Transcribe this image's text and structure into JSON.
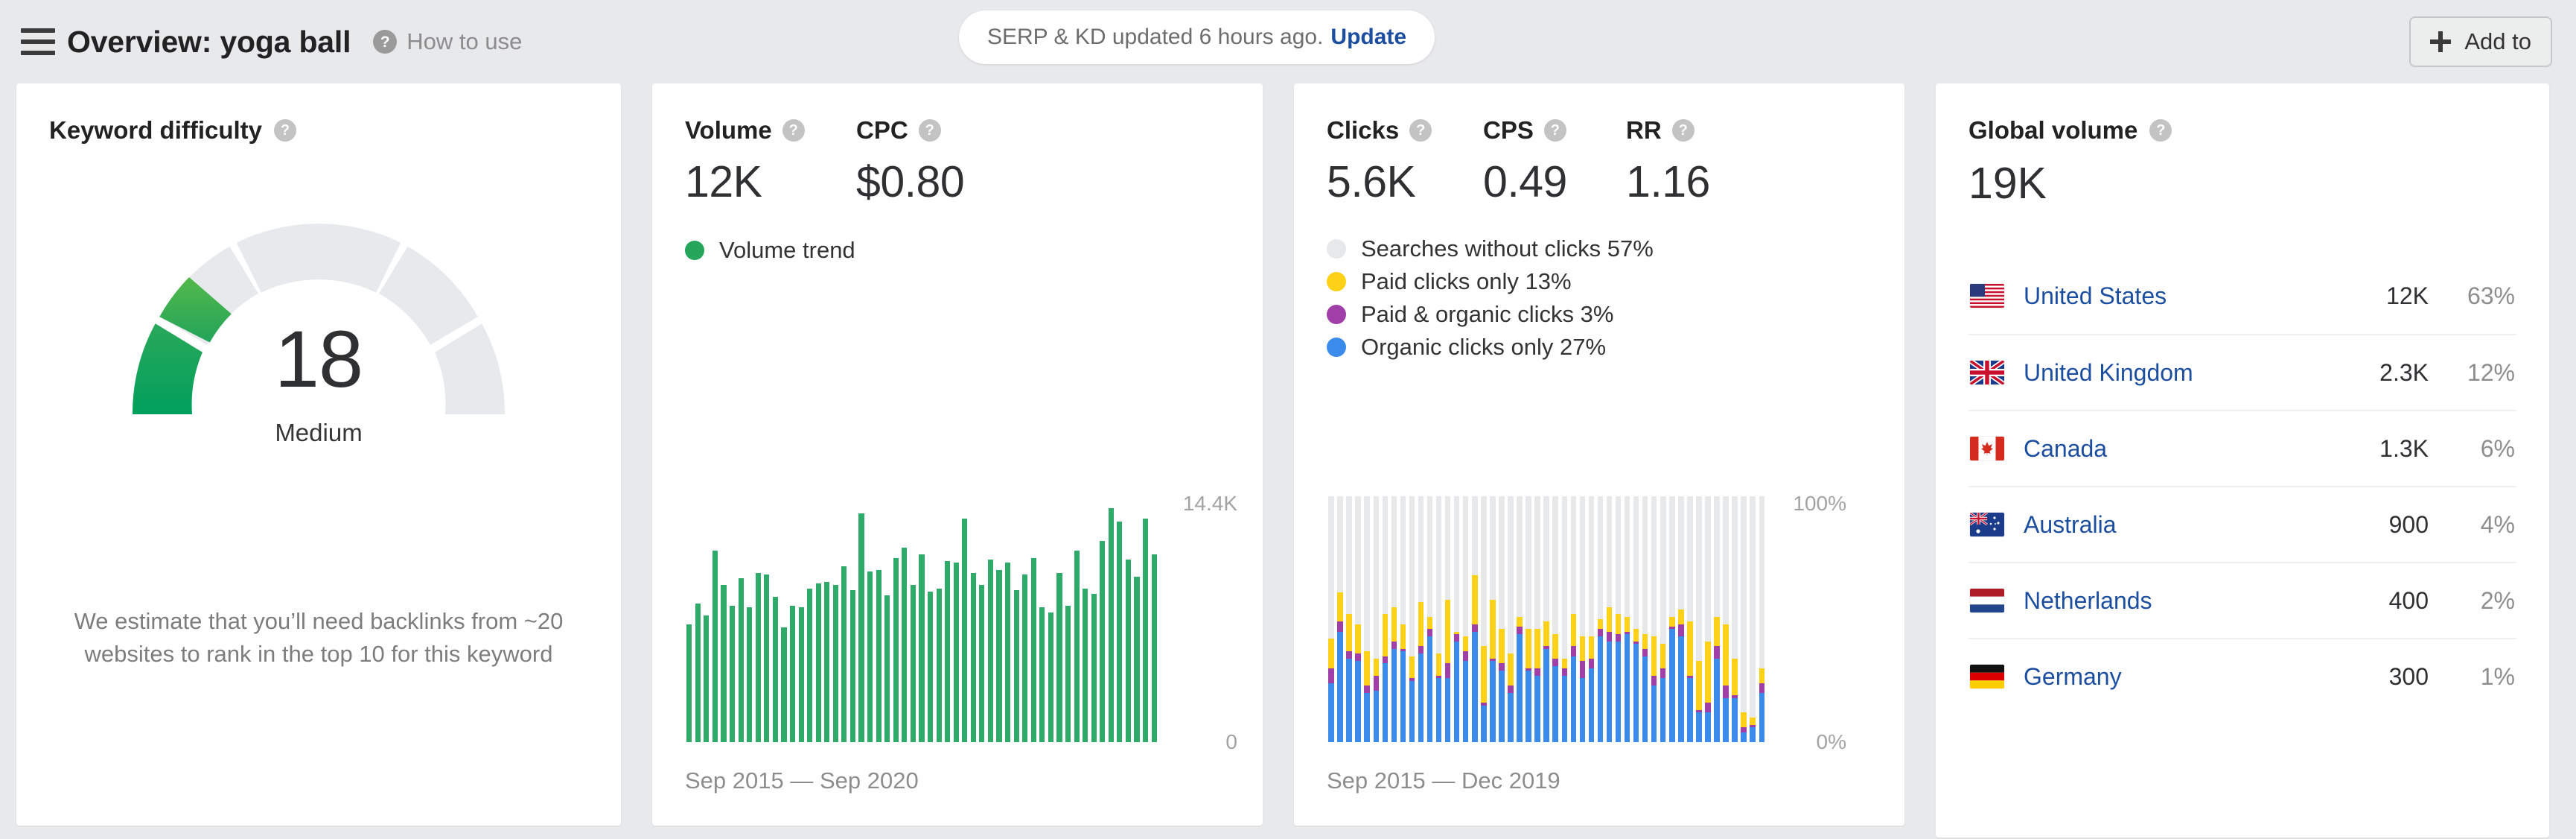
{
  "topbar": {
    "menu_icon": "hamburger-icon",
    "title": "Overview: yoga ball",
    "help_glyph": "?",
    "how_to_use": "How to use",
    "update_notice": "SERP & KD updated 6 hours ago.",
    "update_link": "Update",
    "add_to": "Add to"
  },
  "keyword_difficulty": {
    "title": "Keyword difficulty",
    "value": "18",
    "rating": "Medium",
    "note": "We estimate that you’ll need backlinks from ~20 websites to rank in the top 10 for this keyword",
    "accent": "#2fa84f",
    "track": "#e7eaec"
  },
  "volume_card": {
    "volume_label": "Volume",
    "volume_value": "12K",
    "cpc_label": "CPC",
    "cpc_value": "$0.80",
    "legend_label": "Volume trend",
    "legend_color": "#26a65b",
    "axis_max": "14.4K",
    "axis_min": "0",
    "date_range": "Sep 2015 — Sep 2020"
  },
  "clicks_card": {
    "clicks_label": "Clicks",
    "clicks_value": "5.6K",
    "cps_label": "CPS",
    "cps_value": "0.49",
    "rr_label": "RR",
    "rr_value": "1.16",
    "legend": [
      {
        "label": "Searches without clicks 57%",
        "color": "#e7e8ea"
      },
      {
        "label": "Paid clicks only 13%",
        "color": "#fcd117"
      },
      {
        "label": "Paid & organic clicks 3%",
        "color": "#a03fa8"
      },
      {
        "label": "Organic clicks only 27%",
        "color": "#3a8bea"
      }
    ],
    "axis_max": "100%",
    "axis_min": "0%",
    "date_range": "Sep 2015 — Dec 2019"
  },
  "global_volume": {
    "title": "Global volume",
    "value": "19K",
    "countries": [
      {
        "name": "United States",
        "flag": "us",
        "volume": "12K",
        "pct": "63%"
      },
      {
        "name": "United Kingdom",
        "flag": "gb",
        "volume": "2.3K",
        "pct": "12%"
      },
      {
        "name": "Canada",
        "flag": "ca",
        "volume": "1.3K",
        "pct": "6%"
      },
      {
        "name": "Australia",
        "flag": "au",
        "volume": "900",
        "pct": "4%"
      },
      {
        "name": "Netherlands",
        "flag": "nl",
        "volume": "400",
        "pct": "2%"
      },
      {
        "name": "Germany",
        "flag": "de",
        "volume": "300",
        "pct": "1%"
      }
    ]
  },
  "chart_data": [
    {
      "type": "bar",
      "title": "Volume trend",
      "xlabel": "Sep 2015 — Sep 2020",
      "ylabel": "",
      "ylim": [
        0,
        14400
      ],
      "tick_labels": [
        "0",
        "14.4K"
      ],
      "grid": false,
      "legend": [
        "Volume trend"
      ],
      "series_color": "#2faa68",
      "x": [
        "Sep 2015",
        "Oct 2015",
        "Nov 2015",
        "Dec 2015",
        "Jan 2016",
        "Feb 2016",
        "Mar 2016",
        "Apr 2016",
        "May 2016",
        "Jun 2016",
        "Jul 2016",
        "Aug 2016",
        "Sep 2016",
        "Oct 2016",
        "Nov 2016",
        "Dec 2016",
        "Jan 2017",
        "Feb 2017",
        "Mar 2017",
        "Apr 2017",
        "May 2017",
        "Jun 2017",
        "Jul 2017",
        "Aug 2017",
        "Sep 2017",
        "Oct 2017",
        "Nov 2017",
        "Dec 2017",
        "Jan 2018",
        "Feb 2018",
        "Mar 2018",
        "Apr 2018",
        "May 2018",
        "Jun 2018",
        "Jul 2018",
        "Aug 2018",
        "Sep 2018",
        "Oct 2018",
        "Nov 2018",
        "Dec 2018",
        "Jan 2019",
        "Feb 2019",
        "Mar 2019",
        "Apr 2019",
        "May 2019",
        "Jun 2019",
        "Jul 2019",
        "Aug 2019",
        "Sep 2019",
        "Oct 2019",
        "Nov 2019",
        "Dec 2019",
        "Jan 2020",
        "Feb 2020",
        "Mar 2020",
        "Apr 2020",
        "May 2020",
        "Jun 2020",
        "Jul 2020",
        "Aug 2020",
        "Sep 2020"
      ],
      "values": [
        6900,
        8100,
        7400,
        11200,
        9200,
        8000,
        9600,
        7900,
        9900,
        9800,
        8500,
        6700,
        8000,
        7900,
        9000,
        9300,
        9400,
        9200,
        10300,
        8900,
        13400,
        10000,
        10100,
        8600,
        10800,
        11400,
        9200,
        11000,
        8800,
        9000,
        10600,
        10500,
        13100,
        9900,
        9200,
        10700,
        10100,
        10500,
        8900,
        9800,
        10800,
        7900,
        7600,
        9900,
        8000,
        11200,
        9000,
        8700,
        11800,
        13700,
        12900,
        10700,
        9700,
        13100,
        11000
      ]
    },
    {
      "type": "bar",
      "stacked": true,
      "title": "Clicks breakdown",
      "xlabel": "Sep 2015 — Dec 2019",
      "ylabel": "",
      "ylim": [
        0,
        100
      ],
      "tick_labels": [
        "0%",
        "100%"
      ],
      "grid": false,
      "legend": [
        "Organic clicks only",
        "Paid & organic clicks",
        "Paid clicks only",
        "Searches without clicks"
      ],
      "series": [
        {
          "name": "Organic clicks only",
          "color": "#3a8bea",
          "values": [
            24,
            45,
            34,
            33,
            20,
            21,
            32,
            38,
            37,
            25,
            36,
            43,
            26,
            26,
            41,
            33,
            45,
            15,
            33,
            29,
            20,
            44,
            29,
            27,
            38,
            31,
            27,
            35,
            26,
            30,
            43,
            41,
            41,
            44,
            40,
            35,
            23,
            26,
            46,
            43,
            26,
            12,
            12,
            34,
            18,
            18,
            4,
            6,
            20
          ]
        },
        {
          "name": "Paid & organic clicks",
          "color": "#a03fa8",
          "values": [
            6,
            4,
            3,
            3,
            3,
            6,
            3,
            3,
            1,
            1,
            3,
            3,
            1,
            6,
            3,
            4,
            3,
            1,
            1,
            3,
            3,
            3,
            1,
            3,
            1,
            3,
            3,
            4,
            7,
            4,
            3,
            4,
            3,
            1,
            1,
            3,
            4,
            4,
            1,
            5,
            1,
            1,
            4,
            5,
            5,
            1,
            2,
            1,
            4
          ]
        },
        {
          "name": "Paid clicks only",
          "color": "#fcd117",
          "values": [
            12,
            12,
            15,
            12,
            14,
            7,
            17,
            14,
            10,
            9,
            18,
            5,
            9,
            26,
            1,
            6,
            20,
            23,
            24,
            14,
            13,
            4,
            16,
            16,
            10,
            10,
            4,
            13,
            10,
            9,
            4,
            10,
            8,
            6,
            5,
            6,
            16,
            10,
            4,
            6,
            22,
            20,
            25,
            12,
            25,
            15,
            6,
            3,
            6
          ]
        }
      ]
    }
  ]
}
